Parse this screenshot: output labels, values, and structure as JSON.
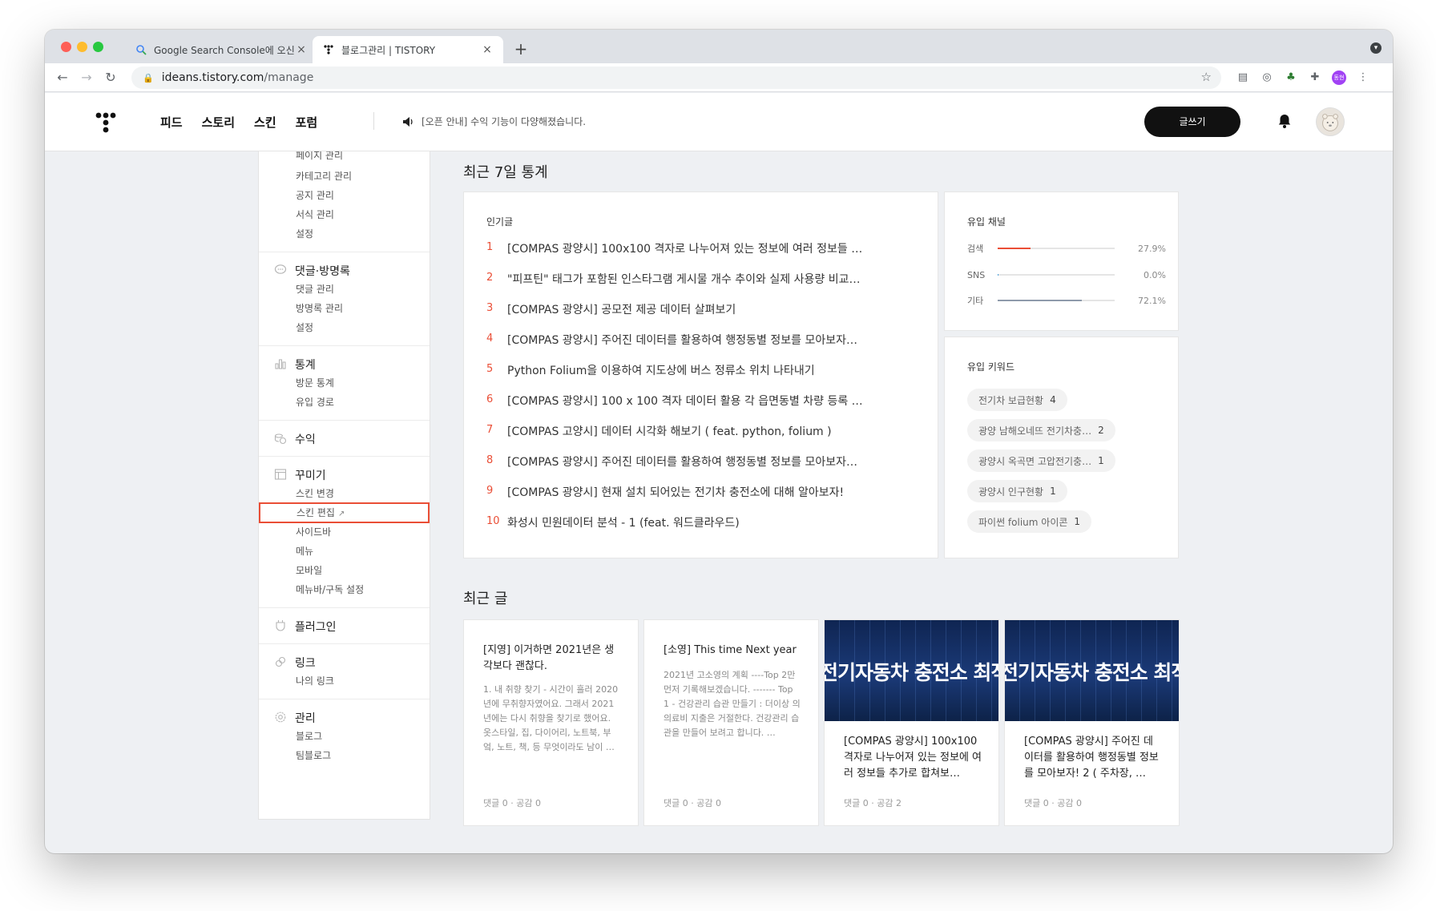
{
  "browser": {
    "tabs": [
      {
        "title": "Google Search Console에 오신",
        "icon": "google-search-console-icon",
        "active": false
      },
      {
        "title": "블로그관리 | TISTORY",
        "icon": "tistory-icon",
        "active": true
      }
    ],
    "url_host": "ideans.tistory.com",
    "url_path": "/manage",
    "profile_avatar": "동현"
  },
  "header": {
    "nav": [
      "피드",
      "스토리",
      "스킨",
      "포럼"
    ],
    "notice": "[오픈 안내] 수익 기능이 다양해졌습니다.",
    "write_label": "글쓰기"
  },
  "sidebar": {
    "groups": [
      {
        "title": "",
        "icon": "",
        "items": [
          "페이지 관리",
          "카테고리 관리",
          "공지 관리",
          "서식 관리",
          "설정"
        ]
      },
      {
        "title": "댓글·방명록",
        "icon": "comment-icon",
        "items": [
          "댓글 관리",
          "방명록 관리",
          "설정"
        ]
      },
      {
        "title": "통계",
        "icon": "chart-icon",
        "items": [
          "방문 통계",
          "유입 경로"
        ]
      },
      {
        "title": "수익",
        "icon": "coins-icon",
        "items": []
      },
      {
        "title": "꾸미기",
        "icon": "layout-icon",
        "items": [
          "스킨 변경",
          "스킨 편집",
          "사이드바",
          "메뉴",
          "모바일",
          "메뉴바/구독 설정"
        ]
      },
      {
        "title": "플러그인",
        "icon": "plugin-icon",
        "items": []
      },
      {
        "title": "링크",
        "icon": "link-icon",
        "items": [
          "나의 링크"
        ]
      },
      {
        "title": "관리",
        "icon": "gear-icon",
        "items": [
          "블로그",
          "팀블로그"
        ]
      }
    ],
    "highlighted_item": "스킨 편집"
  },
  "stats": {
    "section_title": "최근 7일 통계",
    "popular_label": "인기글",
    "popular_posts": [
      {
        "rank": "1",
        "title": "[COMPAS 광양시] 100x100 격자로 나누어져 있는 정보에 여러 정보들 …"
      },
      {
        "rank": "2",
        "title": "\"피프틴\" 태그가 포함된 인스타그램 게시물 개수 추이와 실제 사용량 비교…"
      },
      {
        "rank": "3",
        "title": "[COMPAS 광양시] 공모전 제공 데이터 살펴보기"
      },
      {
        "rank": "4",
        "title": "[COMPAS 광양시] 주어진 데이터를 활용하여 행정동별 정보를 모아보자…"
      },
      {
        "rank": "5",
        "title": "Python Folium을 이용하여 지도상에 버스 정류소 위치 나타내기"
      },
      {
        "rank": "6",
        "title": "[COMPAS 광양시] 100 x 100 격자 데이터 활용 각 읍면동별 차량 등록 …"
      },
      {
        "rank": "7",
        "title": "[COMPAS 고양시] 데이터 시각화 해보기 ( feat. python, folium )"
      },
      {
        "rank": "8",
        "title": "[COMPAS 광양시] 주어진 데이터를 활용하여 행정동별 정보를 모아보자…"
      },
      {
        "rank": "9",
        "title": "[COMPAS 광양시] 현재 설치 되어있는 전기차 충전소에 대해 알아보자!"
      },
      {
        "rank": "10",
        "title": "화성시 민원데이터 분석 - 1 (feat. 워드클라우드)"
      }
    ],
    "channel_label": "유입 채널",
    "channels": [
      {
        "name": "검색",
        "pct_label": "27.9%",
        "value": 27.9,
        "color": "#ea4e36"
      },
      {
        "name": "SNS",
        "pct_label": "0.0%",
        "value": 0.0,
        "color": "#4aa3df"
      },
      {
        "name": "기타",
        "pct_label": "72.1%",
        "value": 72.1,
        "color": "#8e9aab"
      }
    ],
    "keyword_label": "유입 키워드",
    "keywords": [
      {
        "text": "전기차 보급현황",
        "count": "4"
      },
      {
        "text": "광양 남해오네뜨 전기차충…",
        "count": "2"
      },
      {
        "text": "광양시 옥곡면 고압전기충…",
        "count": "1"
      },
      {
        "text": "광양시 인구현황",
        "count": "1"
      },
      {
        "text": "파이썬 folium 아이콘",
        "count": "1"
      }
    ]
  },
  "recent": {
    "section_title": "최근 글",
    "posts": [
      {
        "title": "[지영] 이거하면 2021년은 생각보다 괜찮다.",
        "excerpt": "1. 내 취향 찾기 - 시간이 흘러 2020년에 무취향자였어요. 그래서 2021년에는 다시 취향을 찾기로 했어요. 옷스타일, 집, 다이어리, 노트북, 부엌, 노트, 책, 등 무엇이라도 남이 …",
        "meta": "댓글 0 · 공감 0",
        "thumb": ""
      },
      {
        "title": "[소영] This time Next year",
        "excerpt": "2021년 고소영의 계획 ----Top 2만 먼저 기록해보겠습니다. ------- Top 1 - 건강관리 습관 만들기 : 더이상 의 의료비 지출은 거절한다. 건강관리 습관을 만들어 보려고 합니다. …",
        "meta": "댓글 0 · 공감 0",
        "thumb": ""
      },
      {
        "title": "[COMPAS 광양시] 100x100 격자로 나누어져 있는 정보에 여러 정보들 추가로 합쳐보…",
        "excerpt": "",
        "meta": "댓글 0 · 공감 2",
        "thumb": "전기자동차 충전소 최적"
      },
      {
        "title": "[COMPAS 광양시] 주어진 데이터를 활용하여 행정동별 정보를 모아보자! 2 ( 주차장, …",
        "excerpt": "",
        "meta": "댓글 0 · 공감 0",
        "thumb": "전기자동차 충전소 최적"
      }
    ]
  }
}
